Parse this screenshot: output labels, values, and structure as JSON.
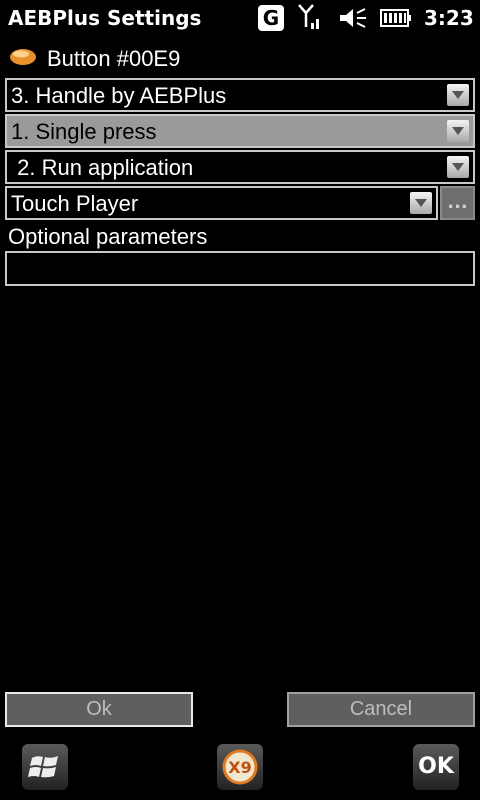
{
  "status_bar": {
    "title": "AEBPlus Settings",
    "g_icon_text": "G",
    "time": "3:23",
    "icons": [
      "g-icon",
      "signal-icon",
      "volume-icon",
      "battery-icon"
    ]
  },
  "header": {
    "icon": "pill-icon",
    "button_name": "Button #00E9"
  },
  "combos": [
    {
      "value": "3. Handle by AEBPlus",
      "selected": false
    },
    {
      "value": "1. Single press",
      "selected": true
    },
    {
      "value": " 2. Run application",
      "selected": false
    },
    {
      "value": "Touch Player",
      "selected": false
    }
  ],
  "browse_button": {
    "label": "..."
  },
  "params": {
    "label": "Optional parameters",
    "value": ""
  },
  "dialog_buttons": {
    "ok_label": "Ok",
    "cancel_label": "Cancel"
  },
  "taskbar": {
    "start_icon": "windows-logo-icon",
    "app_icon": "x9-icon",
    "app_icon_text": "X9",
    "ok_label": "OK"
  },
  "colors": {
    "background": "#000000",
    "selected_row": "#9a9a9a",
    "border": "#c8c8c8",
    "dialog_button": "#5f5f5f",
    "pill": "#f0a040"
  }
}
